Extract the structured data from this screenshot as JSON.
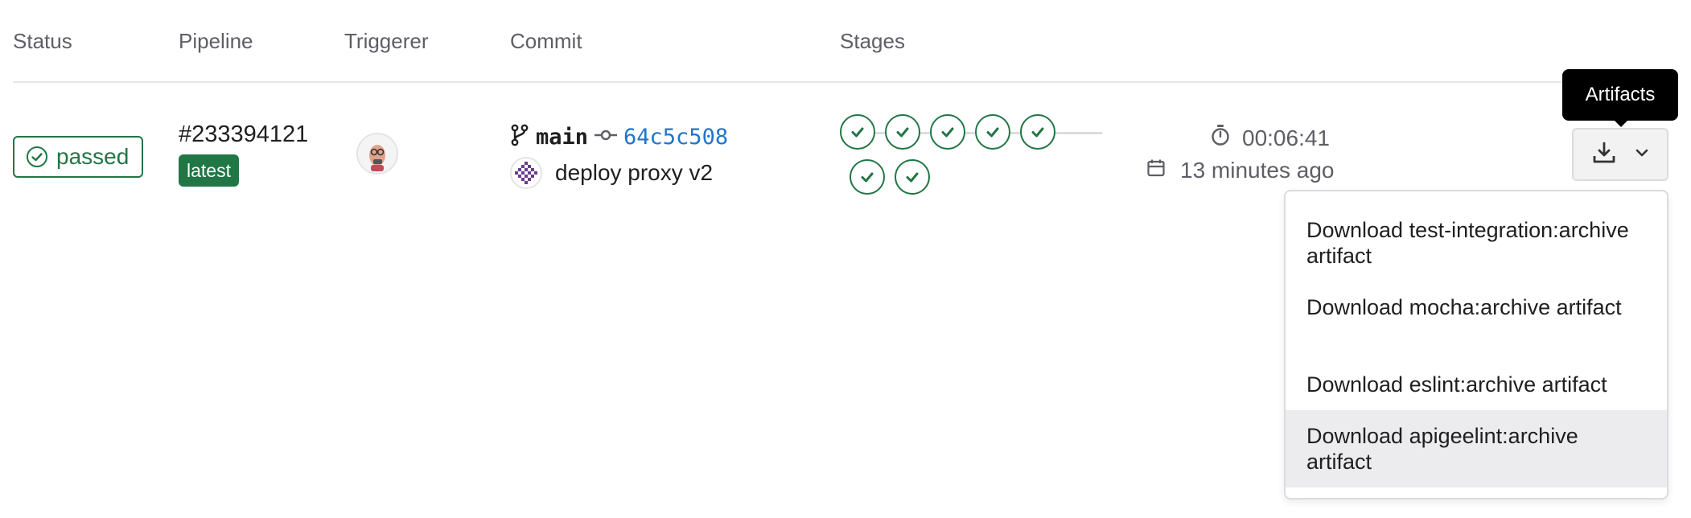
{
  "table": {
    "headers": [
      "Status",
      "Pipeline",
      "Triggerer",
      "Commit",
      "Stages"
    ]
  },
  "row": {
    "status": "passed",
    "pipeline_id": "#233394121",
    "pipeline_badge": "latest",
    "branch": "main",
    "commit_sha": "64c5c508",
    "commit_title": "deploy proxy v2",
    "stages_count": 7,
    "stage_status": "passed",
    "duration": "00:06:41",
    "finished": "13 minutes ago"
  },
  "artifacts": {
    "tooltip": "Artifacts",
    "items": [
      "Download test-integration:archive artifact",
      "Download mocha:archive artifact",
      "Download eslint:archive artifact",
      "Download apigeelint:archive artifact"
    ],
    "highlighted_index": 3
  },
  "colors": {
    "success": "#217645",
    "link": "#1f75cb",
    "muted": "#5e5e66"
  },
  "icons": {
    "status": "check-circle-icon",
    "branch": "branch-icon",
    "commit": "commit-icon",
    "duration": "timer-icon",
    "finished": "calendar-icon",
    "artifacts": "download-icon",
    "dropdown": "chevron-down-icon"
  }
}
